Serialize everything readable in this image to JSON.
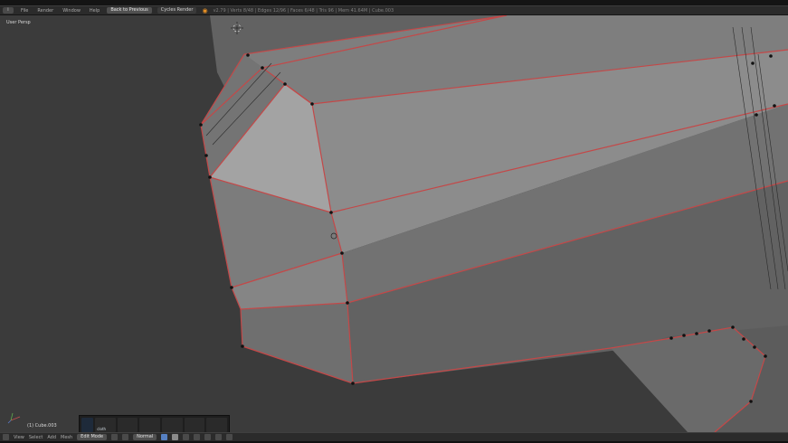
{
  "top_bar": {
    "menus": [
      "File",
      "Render",
      "Window",
      "Help"
    ],
    "layout": "Back to Previous",
    "engine": "Cycles Render",
    "file_path": "v2.79 | Verts 8/48 | Edges 12/96 | Faces 6/48 | Tris 96 | Mem 41.64M | Cube.003"
  },
  "viewport": {
    "view_label": "User Persp",
    "object_label": "(1) Cube.003",
    "colors": {
      "background": "#3d3d3d",
      "face_light": "#8f8f8f",
      "face_mid": "#6e6e6e",
      "selected_edge": "#c44848",
      "vertex": "#111111"
    }
  },
  "tool_palette": {
    "first_slot_label": "cloth"
  },
  "bottom_bar": {
    "menus": [
      "View",
      "Select",
      "Add",
      "Mesh"
    ],
    "mode": "Edit Mode",
    "pivot": "Normal"
  }
}
